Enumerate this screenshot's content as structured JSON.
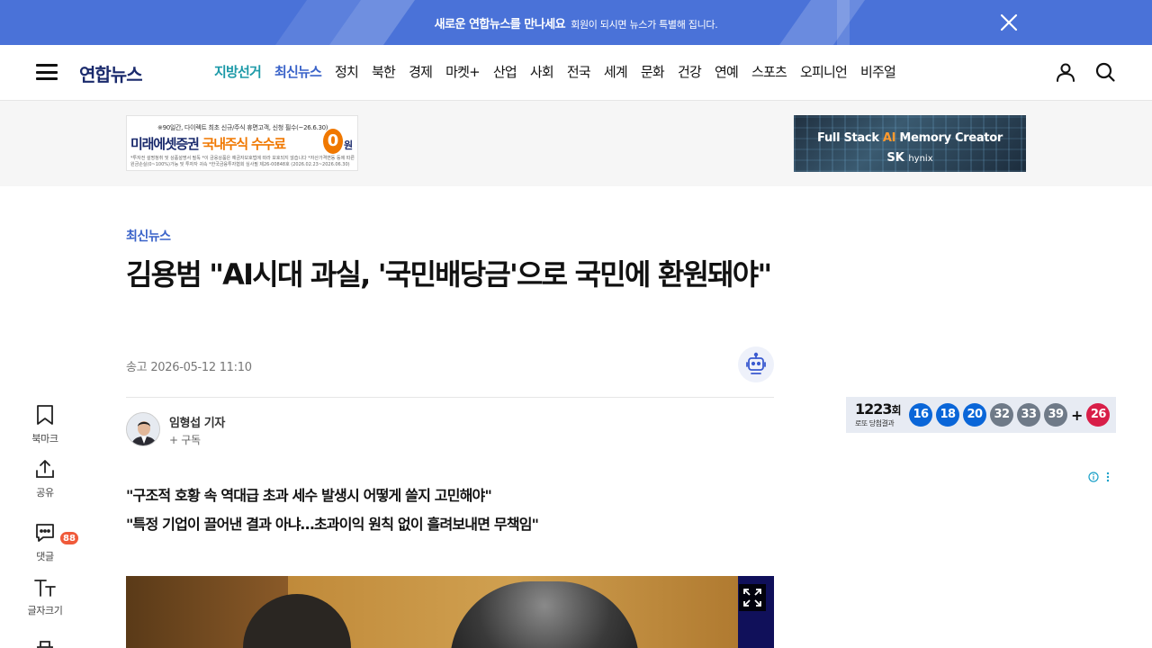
{
  "promo": {
    "title": "새로운 연합뉴스를 만나세요",
    "subtitle": "회원이 되시면 뉴스가 특별해 집니다."
  },
  "header": {
    "logo": "연합뉴스",
    "nav": [
      {
        "label": "지방선거",
        "style": "teal"
      },
      {
        "label": "최신뉴스",
        "style": "blue"
      },
      {
        "label": "정치"
      },
      {
        "label": "북한"
      },
      {
        "label": "경제"
      },
      {
        "label": "마켓+"
      },
      {
        "label": "산업"
      },
      {
        "label": "사회"
      },
      {
        "label": "전국"
      },
      {
        "label": "세계"
      },
      {
        "label": "문화"
      },
      {
        "label": "건강"
      },
      {
        "label": "연예"
      },
      {
        "label": "스포츠"
      },
      {
        "label": "오피니언"
      },
      {
        "label": "비주얼"
      }
    ]
  },
  "ads": {
    "left": {
      "top_line": "※90일간, 다이렉트 최초 신규/주식 휴면고객, 신청 필수(~26.6.30)",
      "company": "미래에셋증권",
      "offer": "국내주식 수수료",
      "zero": "0",
      "won": "원",
      "fine_print": "*투자전 설명청취 및 상품설명서 필독 *이 금융상품은 예금자보호법에 따라 보호되지 않습니다 *자산가격변동 등에 따른 원금손실(0~100%)가능 및 투자자 귀속 *한국금융투자협회 심사필 제26-00848호 (2026.02.23~2026.06.30)"
    },
    "right": {
      "headline_pre": "Full Stack ",
      "headline_ai": "AI",
      "headline_post": " Memory Creator",
      "brand": "SK",
      "brand_small": "hynix"
    }
  },
  "article": {
    "category": "최신뉴스",
    "headline": "김용범 \"AI시대 과실, '국민배당금'으로 국민에 환원돼야\"",
    "date_label": "송고",
    "date": "2026-05-12 11:10",
    "reporter": "임형섭 기자",
    "subscribe": "+ 구독",
    "subheads": [
      "\"구조적 호황 속 역대급 초과 세수 발생시 어떻게 쓸지 고민해야\"",
      "\"특정 기업이 끌어낸 결과 아냐…초과이익 원칙 없이 흘려보내면 무책임\""
    ]
  },
  "toolbar": {
    "bookmark": "북마크",
    "share": "공유",
    "comments": "댓글",
    "comment_count": "88",
    "font_size": "글자크기"
  },
  "lotto": {
    "round": "1223",
    "round_unit": "회",
    "label": "로또 당첨결과",
    "numbers": [
      "16",
      "18",
      "20",
      "32",
      "33",
      "39"
    ],
    "bonus": "26",
    "colors": {
      "blue": "#0a66d8",
      "gray": "#6f7a88",
      "red": "#d81e48"
    }
  },
  "colors": {
    "promo_bg": "#4a72d8",
    "accent_blue": "#3a63c9",
    "accent_teal": "#1d9aa8",
    "logo": "#1a2a6c"
  }
}
